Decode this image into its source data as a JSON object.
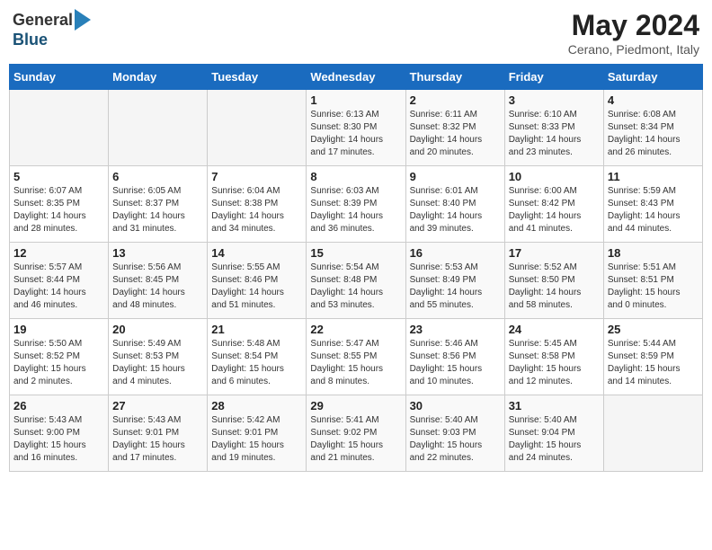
{
  "header": {
    "logo_general": "General",
    "logo_blue": "Blue",
    "month_year": "May 2024",
    "location": "Cerano, Piedmont, Italy"
  },
  "weekdays": [
    "Sunday",
    "Monday",
    "Tuesday",
    "Wednesday",
    "Thursday",
    "Friday",
    "Saturday"
  ],
  "weeks": [
    [
      {
        "day": "",
        "info": ""
      },
      {
        "day": "",
        "info": ""
      },
      {
        "day": "",
        "info": ""
      },
      {
        "day": "1",
        "info": "Sunrise: 6:13 AM\nSunset: 8:30 PM\nDaylight: 14 hours\nand 17 minutes."
      },
      {
        "day": "2",
        "info": "Sunrise: 6:11 AM\nSunset: 8:32 PM\nDaylight: 14 hours\nand 20 minutes."
      },
      {
        "day": "3",
        "info": "Sunrise: 6:10 AM\nSunset: 8:33 PM\nDaylight: 14 hours\nand 23 minutes."
      },
      {
        "day": "4",
        "info": "Sunrise: 6:08 AM\nSunset: 8:34 PM\nDaylight: 14 hours\nand 26 minutes."
      }
    ],
    [
      {
        "day": "5",
        "info": "Sunrise: 6:07 AM\nSunset: 8:35 PM\nDaylight: 14 hours\nand 28 minutes."
      },
      {
        "day": "6",
        "info": "Sunrise: 6:05 AM\nSunset: 8:37 PM\nDaylight: 14 hours\nand 31 minutes."
      },
      {
        "day": "7",
        "info": "Sunrise: 6:04 AM\nSunset: 8:38 PM\nDaylight: 14 hours\nand 34 minutes."
      },
      {
        "day": "8",
        "info": "Sunrise: 6:03 AM\nSunset: 8:39 PM\nDaylight: 14 hours\nand 36 minutes."
      },
      {
        "day": "9",
        "info": "Sunrise: 6:01 AM\nSunset: 8:40 PM\nDaylight: 14 hours\nand 39 minutes."
      },
      {
        "day": "10",
        "info": "Sunrise: 6:00 AM\nSunset: 8:42 PM\nDaylight: 14 hours\nand 41 minutes."
      },
      {
        "day": "11",
        "info": "Sunrise: 5:59 AM\nSunset: 8:43 PM\nDaylight: 14 hours\nand 44 minutes."
      }
    ],
    [
      {
        "day": "12",
        "info": "Sunrise: 5:57 AM\nSunset: 8:44 PM\nDaylight: 14 hours\nand 46 minutes."
      },
      {
        "day": "13",
        "info": "Sunrise: 5:56 AM\nSunset: 8:45 PM\nDaylight: 14 hours\nand 48 minutes."
      },
      {
        "day": "14",
        "info": "Sunrise: 5:55 AM\nSunset: 8:46 PM\nDaylight: 14 hours\nand 51 minutes."
      },
      {
        "day": "15",
        "info": "Sunrise: 5:54 AM\nSunset: 8:48 PM\nDaylight: 14 hours\nand 53 minutes."
      },
      {
        "day": "16",
        "info": "Sunrise: 5:53 AM\nSunset: 8:49 PM\nDaylight: 14 hours\nand 55 minutes."
      },
      {
        "day": "17",
        "info": "Sunrise: 5:52 AM\nSunset: 8:50 PM\nDaylight: 14 hours\nand 58 minutes."
      },
      {
        "day": "18",
        "info": "Sunrise: 5:51 AM\nSunset: 8:51 PM\nDaylight: 15 hours\nand 0 minutes."
      }
    ],
    [
      {
        "day": "19",
        "info": "Sunrise: 5:50 AM\nSunset: 8:52 PM\nDaylight: 15 hours\nand 2 minutes."
      },
      {
        "day": "20",
        "info": "Sunrise: 5:49 AM\nSunset: 8:53 PM\nDaylight: 15 hours\nand 4 minutes."
      },
      {
        "day": "21",
        "info": "Sunrise: 5:48 AM\nSunset: 8:54 PM\nDaylight: 15 hours\nand 6 minutes."
      },
      {
        "day": "22",
        "info": "Sunrise: 5:47 AM\nSunset: 8:55 PM\nDaylight: 15 hours\nand 8 minutes."
      },
      {
        "day": "23",
        "info": "Sunrise: 5:46 AM\nSunset: 8:56 PM\nDaylight: 15 hours\nand 10 minutes."
      },
      {
        "day": "24",
        "info": "Sunrise: 5:45 AM\nSunset: 8:58 PM\nDaylight: 15 hours\nand 12 minutes."
      },
      {
        "day": "25",
        "info": "Sunrise: 5:44 AM\nSunset: 8:59 PM\nDaylight: 15 hours\nand 14 minutes."
      }
    ],
    [
      {
        "day": "26",
        "info": "Sunrise: 5:43 AM\nSunset: 9:00 PM\nDaylight: 15 hours\nand 16 minutes."
      },
      {
        "day": "27",
        "info": "Sunrise: 5:43 AM\nSunset: 9:01 PM\nDaylight: 15 hours\nand 17 minutes."
      },
      {
        "day": "28",
        "info": "Sunrise: 5:42 AM\nSunset: 9:01 PM\nDaylight: 15 hours\nand 19 minutes."
      },
      {
        "day": "29",
        "info": "Sunrise: 5:41 AM\nSunset: 9:02 PM\nDaylight: 15 hours\nand 21 minutes."
      },
      {
        "day": "30",
        "info": "Sunrise: 5:40 AM\nSunset: 9:03 PM\nDaylight: 15 hours\nand 22 minutes."
      },
      {
        "day": "31",
        "info": "Sunrise: 5:40 AM\nSunset: 9:04 PM\nDaylight: 15 hours\nand 24 minutes."
      },
      {
        "day": "",
        "info": ""
      }
    ]
  ]
}
